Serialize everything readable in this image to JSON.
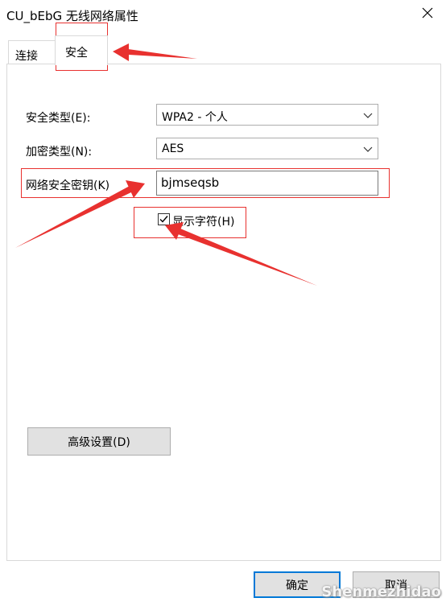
{
  "window": {
    "title": "CU_bEbG 无线网络属性"
  },
  "tabs": [
    {
      "label": "连接"
    },
    {
      "label": "安全"
    }
  ],
  "security_type": {
    "label": "安全类型(E):",
    "value": "WPA2 - 个人"
  },
  "encryption_type": {
    "label": "加密类型(N):",
    "value": "AES"
  },
  "network_key": {
    "label": "网络安全密钥(K)",
    "value": "bjmseqsb"
  },
  "show_characters": {
    "label": "显示字符(H)",
    "checked": true
  },
  "buttons": {
    "advanced": "高级设置(D)",
    "ok": "确定",
    "cancel": "取消"
  },
  "watermark": "Shenmezhidao",
  "accent": {
    "highlight": "#e8312f",
    "focus": "#0078d7"
  }
}
